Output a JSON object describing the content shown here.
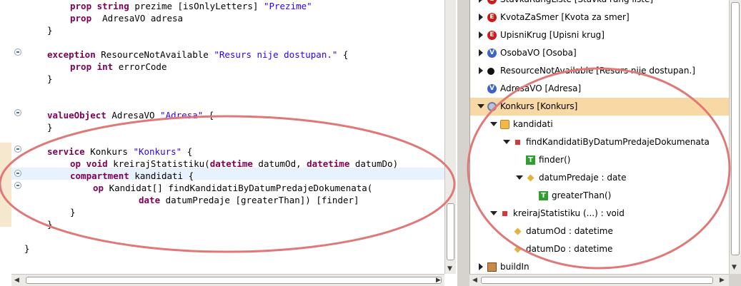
{
  "editor": {
    "lines": [
      {
        "indent": 2,
        "parts": [
          [
            "kw",
            "prop string "
          ],
          [
            "t",
            "prezime [isOnlyLetters] "
          ],
          [
            "str",
            "\"Prezime\""
          ]
        ]
      },
      {
        "indent": 2,
        "parts": [
          [
            "kw",
            "prop  "
          ],
          [
            "t",
            "AdresaVO adresa"
          ]
        ]
      },
      {
        "indent": 1,
        "parts": [
          [
            "t",
            "}"
          ]
        ]
      },
      {
        "indent": 0,
        "parts": [
          [
            "t",
            ""
          ]
        ]
      },
      {
        "indent": 1,
        "parts": [
          [
            "kw",
            "exception "
          ],
          [
            "t",
            "ResourceNotAvailable "
          ],
          [
            "str",
            "\"Resurs nije dostupan.\""
          ],
          [
            "t",
            " {"
          ]
        ]
      },
      {
        "indent": 2,
        "parts": [
          [
            "kw",
            "prop int "
          ],
          [
            "t",
            "errorCode"
          ]
        ]
      },
      {
        "indent": 1,
        "parts": [
          [
            "t",
            "}"
          ]
        ]
      },
      {
        "indent": 0,
        "parts": [
          [
            "t",
            ""
          ]
        ]
      },
      {
        "indent": 0,
        "parts": [
          [
            "t",
            ""
          ]
        ]
      },
      {
        "indent": 1,
        "parts": [
          [
            "kw",
            "valueObject "
          ],
          [
            "t",
            "AdresaVO "
          ],
          [
            "str",
            "\"Adresa\""
          ],
          [
            "t",
            " {"
          ]
        ]
      },
      {
        "indent": 1,
        "parts": [
          [
            "t",
            "}"
          ]
        ]
      },
      {
        "indent": 0,
        "parts": [
          [
            "t",
            ""
          ]
        ]
      },
      {
        "indent": 1,
        "parts": [
          [
            "kw",
            "service "
          ],
          [
            "t",
            "Konkurs "
          ],
          [
            "str",
            "\"Konkurs\""
          ],
          [
            "t",
            " {"
          ]
        ]
      },
      {
        "indent": 2,
        "parts": [
          [
            "kw",
            "op void "
          ],
          [
            "t",
            "kreirajStatistiku("
          ],
          [
            "kw",
            "datetime "
          ],
          [
            "t",
            "datumOd, "
          ],
          [
            "kw",
            "datetime "
          ],
          [
            "t",
            "datumDo)"
          ]
        ]
      },
      {
        "indent": 2,
        "parts": [
          [
            "kw",
            "compartment "
          ],
          [
            "t",
            "kandidati {"
          ]
        ]
      },
      {
        "indent": 3,
        "parts": [
          [
            "kw",
            "op "
          ],
          [
            "t",
            "Kandidat[] findKandidatiByDatumPredajeDokumenata("
          ]
        ]
      },
      {
        "indent": 5,
        "parts": [
          [
            "kw",
            "date "
          ],
          [
            "t",
            "datumPredaje [greaterThan]) [finder]"
          ]
        ]
      },
      {
        "indent": 2,
        "parts": [
          [
            "t",
            "}"
          ]
        ]
      },
      {
        "indent": 1,
        "parts": [
          [
            "t",
            "}"
          ]
        ]
      },
      {
        "indent": 0,
        "parts": [
          [
            "t",
            ""
          ]
        ]
      },
      {
        "indent": 0,
        "parts": [
          [
            "t",
            "}"
          ]
        ]
      }
    ]
  },
  "tree": {
    "items": [
      {
        "depth": 0,
        "twisty": "closed",
        "icon": "E",
        "label": "StavkaRangListe [Stavka rang liste]"
      },
      {
        "depth": 0,
        "twisty": "closed",
        "icon": "E",
        "label": "KvotaZaSmer [Kvota za smer]"
      },
      {
        "depth": 0,
        "twisty": "closed",
        "icon": "E",
        "label": "UpisniKrug [Upisni krug]"
      },
      {
        "depth": 0,
        "twisty": "closed",
        "icon": "V",
        "label": "OsobaVO [Osoba]"
      },
      {
        "depth": 0,
        "twisty": "closed",
        "icon": "bomb",
        "label": "ResourceNotAvailable [Resurs nije dostupan.]"
      },
      {
        "depth": 0,
        "twisty": "none",
        "icon": "V",
        "label": "AdresaVO [Adresa]"
      },
      {
        "depth": 0,
        "twisty": "open",
        "icon": "gear",
        "label": "Konkurs [Konkurs]",
        "selected": true
      },
      {
        "depth": 1,
        "twisty": "open",
        "icon": "folder",
        "label": "kandidati"
      },
      {
        "depth": 2,
        "twisty": "open",
        "icon": "sq",
        "label": "findKandidatiByDatumPredajeDokumenata"
      },
      {
        "depth": 3,
        "twisty": "none",
        "icon": "T",
        "label": "finder()"
      },
      {
        "depth": 3,
        "twisty": "open",
        "icon": "dia",
        "label": "datumPredaje : date"
      },
      {
        "depth": 4,
        "twisty": "none",
        "icon": "T",
        "label": "greaterThan()"
      },
      {
        "depth": 1,
        "twisty": "open",
        "icon": "sq",
        "label": "kreirajStatistiku (...) : void"
      },
      {
        "depth": 2,
        "twisty": "none",
        "icon": "dia",
        "label": "datumOd : datetime"
      },
      {
        "depth": 2,
        "twisty": "none",
        "icon": "dia",
        "label": "datumDo : datetime"
      },
      {
        "depth": 0,
        "twisty": "closed",
        "icon": "box",
        "label": "buildIn"
      }
    ]
  },
  "colors": {
    "keyword": "#7f0055",
    "string": "#2a00ff",
    "selection": "#f8d8a4",
    "annotation": "#e07878"
  }
}
